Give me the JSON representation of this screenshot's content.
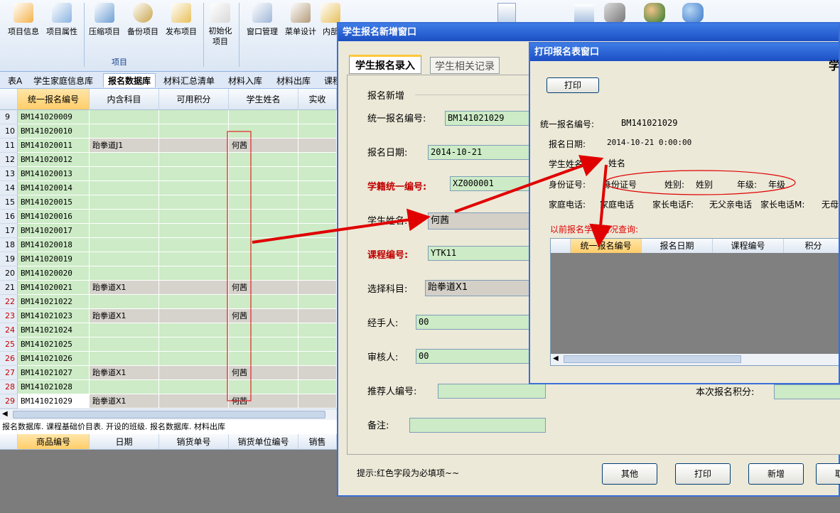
{
  "ribbon": {
    "buttons": [
      "项目信息",
      "项目属性",
      "压缩项目",
      "备份项目",
      "发布项目",
      "初始化\n项目",
      "窗口管理",
      "菜单设计",
      "内部"
    ],
    "group_label": "项目"
  },
  "doc_tabs": [
    "表A",
    "学生家庭信息库",
    "报名数据库",
    "材料汇总清单",
    "材料入库",
    "材料出库",
    "课程"
  ],
  "grid": {
    "columns": [
      "统一报名编号",
      "内含科目",
      "可用积分",
      "学生姓名",
      "实收"
    ],
    "rows": [
      {
        "n": "9",
        "id": "BM141020009",
        "subject": "",
        "points": "",
        "name": "",
        "hl": false
      },
      {
        "n": "10",
        "id": "BM141020010",
        "subject": "",
        "points": "",
        "name": "",
        "hl": false
      },
      {
        "n": "11",
        "id": "BM141020011",
        "subject": "跆拳道J1",
        "points": "",
        "name": "何茜",
        "hl": false
      },
      {
        "n": "12",
        "id": "BM141020012",
        "subject": "",
        "points": "",
        "name": "",
        "hl": false
      },
      {
        "n": "13",
        "id": "BM141020013",
        "subject": "",
        "points": "",
        "name": "",
        "hl": false
      },
      {
        "n": "14",
        "id": "BM141020014",
        "subject": "",
        "points": "",
        "name": "",
        "hl": false
      },
      {
        "n": "15",
        "id": "BM141020015",
        "subject": "",
        "points": "",
        "name": "",
        "hl": false
      },
      {
        "n": "16",
        "id": "BM141020016",
        "subject": "",
        "points": "",
        "name": "",
        "hl": false
      },
      {
        "n": "17",
        "id": "BM141020017",
        "subject": "",
        "points": "",
        "name": "",
        "hl": false
      },
      {
        "n": "18",
        "id": "BM141020018",
        "subject": "",
        "points": "",
        "name": "",
        "hl": false
      },
      {
        "n": "19",
        "id": "BM141020019",
        "subject": "",
        "points": "",
        "name": "",
        "hl": false
      },
      {
        "n": "20",
        "id": "BM141020020",
        "subject": "",
        "points": "",
        "name": "",
        "hl": false
      },
      {
        "n": "21",
        "id": "BM141020021",
        "subject": "跆拳道X1",
        "points": "",
        "name": "何茜",
        "hl": false
      },
      {
        "n": "22",
        "id": "BM141021022",
        "subject": "",
        "points": "",
        "name": "",
        "hl": true
      },
      {
        "n": "23",
        "id": "BM141021023",
        "subject": "跆拳道X1",
        "points": "",
        "name": "何茜",
        "hl": true
      },
      {
        "n": "24",
        "id": "BM141021024",
        "subject": "",
        "points": "",
        "name": "",
        "hl": true
      },
      {
        "n": "25",
        "id": "BM141021025",
        "subject": "",
        "points": "",
        "name": "",
        "hl": true
      },
      {
        "n": "26",
        "id": "BM141021026",
        "subject": "",
        "points": "",
        "name": "",
        "hl": true
      },
      {
        "n": "27",
        "id": "BM141021027",
        "subject": "跆拳道X1",
        "points": "",
        "name": "何茜",
        "hl": true
      },
      {
        "n": "28",
        "id": "BM141021028",
        "subject": "",
        "points": "",
        "name": "",
        "hl": true
      },
      {
        "n": "29",
        "id": "BM141021029",
        "subject": "跆拳道X1",
        "points": "",
        "name": "何茜",
        "hl": true
      }
    ]
  },
  "status_text": "报名数据库. 课程基础价目表. 开设的班级. 报名数据库. 材料出库",
  "grid2": {
    "columns": [
      "商品编号",
      "日期",
      "销货单号",
      "销货单位编号",
      "销售"
    ]
  },
  "win1": {
    "title": "学生报名新增窗口",
    "tab_active": "学生报名录入",
    "tab_other": "学生相关记录",
    "section": "报名新增",
    "fields": {
      "id_label": "统一报名编号:",
      "id_value": "BM141021029",
      "date_label": "报名日期:",
      "date_value": "2014-10-21",
      "reg_label": "学籍统一编号:",
      "reg_value": "XZ000001",
      "name_label": "学生姓名:",
      "name_value": "何茜",
      "course_label": "课程编号:",
      "course_value": "YTK11",
      "subject_label": "选择科目:",
      "subject_value": "跆拳道X1",
      "handler_label": "经手人:",
      "handler_value": "00",
      "reviewer_label": "审核人:",
      "reviewer_value": "00",
      "referrer_label": "推荐人编号:",
      "referrer_value": "",
      "note_label": "备注:",
      "note_value": "",
      "points_label": "本次报名积分:",
      "points_value": ""
    },
    "hint": "提示:红色字段为必填项~~",
    "buttons": {
      "other": "其他",
      "print": "打印",
      "add": "新增",
      "close": "取"
    }
  },
  "win2": {
    "title": "打印报名表窗口",
    "print_btn": "打印",
    "corner_text": "学",
    "id_label": "统一报名编号:",
    "id_value": "BM141021029",
    "date_label": "报名日期:",
    "date_value": "2014-10-21 0:00:00",
    "name_label": "学生姓名:",
    "name_value": "姓名",
    "idcard_label": "身份证号:",
    "idcard_value": "身份证号",
    "gender_label": "姓别:",
    "gender_value": "姓别",
    "grade_label": "年级:",
    "grade_value": "年级",
    "phone_label": "家庭电话:",
    "phone_value": "家庭电话",
    "fphone_label": "家长电话F:",
    "fphone_value": "无父亲电话",
    "mphone_label": "家长电话M:",
    "mphone_value": "无母",
    "history_label": "以前报名学习情况查询:",
    "columns": [
      "统一报名编号",
      "报名日期",
      "课程编号",
      "积分"
    ]
  },
  "colors": {
    "accent_red": "#e00000",
    "title_blue": "#1c4fc4",
    "row_green": "#ccebc6"
  }
}
